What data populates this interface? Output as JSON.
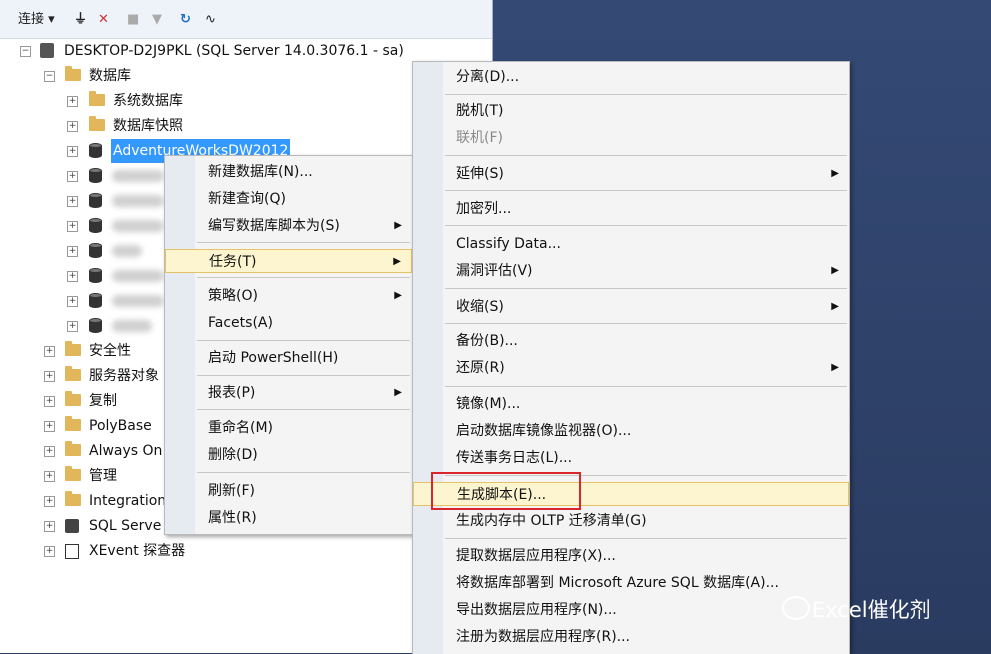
{
  "toolbar": {
    "connect_label": "连接 ▾"
  },
  "tree": {
    "server": "DESKTOP-D2J9PKL (SQL Server 14.0.3076.1 - sa)",
    "databases": "数据库",
    "system_db": "系统数据库",
    "snapshots": "数据库快照",
    "selected_db": "AdventureWorksDW2012",
    "security": "安全性",
    "server_objects": "服务器对象",
    "replication": "复制",
    "polybase": "PolyBase",
    "alwayson": "Always On",
    "management": "管理",
    "integration": "Integration",
    "sqlserver": "SQL Serve",
    "xevent": "XEvent 探查器"
  },
  "context_menu": [
    {
      "label": "新建数据库(N)..."
    },
    {
      "label": "新建查询(Q)"
    },
    {
      "label": "编写数据库脚本为(S)"
    },
    {
      "label": "任务(T)"
    },
    {
      "label": "策略(O)"
    },
    {
      "label": "Facets(A)"
    },
    {
      "label": "启动 PowerShell(H)"
    },
    {
      "label": "报表(P)"
    },
    {
      "label": "重命名(M)"
    },
    {
      "label": "删除(D)"
    },
    {
      "label": "刷新(F)"
    },
    {
      "label": "属性(R)"
    }
  ],
  "tasks_menu": [
    {
      "label": "分离(D)..."
    },
    {
      "label": "脱机(T)"
    },
    {
      "label": "联机(F)"
    },
    {
      "label": "延伸(S)"
    },
    {
      "label": "加密列..."
    },
    {
      "label": "Classify Data..."
    },
    {
      "label": "漏洞评估(V)"
    },
    {
      "label": "收缩(S)"
    },
    {
      "label": "备份(B)..."
    },
    {
      "label": "还原(R)"
    },
    {
      "label": "镜像(M)..."
    },
    {
      "label": "启动数据库镜像监视器(O)..."
    },
    {
      "label": "传送事务日志(L)..."
    },
    {
      "label": "生成脚本(E)..."
    },
    {
      "label": "生成内存中 OLTP 迁移清单(G)"
    },
    {
      "label": "提取数据层应用程序(X)..."
    },
    {
      "label": "将数据库部署到 Microsoft Azure SQL 数据库(A)..."
    },
    {
      "label": "导出数据层应用程序(N)..."
    },
    {
      "label": "注册为数据层应用程序(R)..."
    }
  ],
  "watermark": "Excel催化剂",
  "colors": {
    "highlight": "#fdf5cf",
    "selection": "#3399ff",
    "red_box": "#d9262b"
  }
}
